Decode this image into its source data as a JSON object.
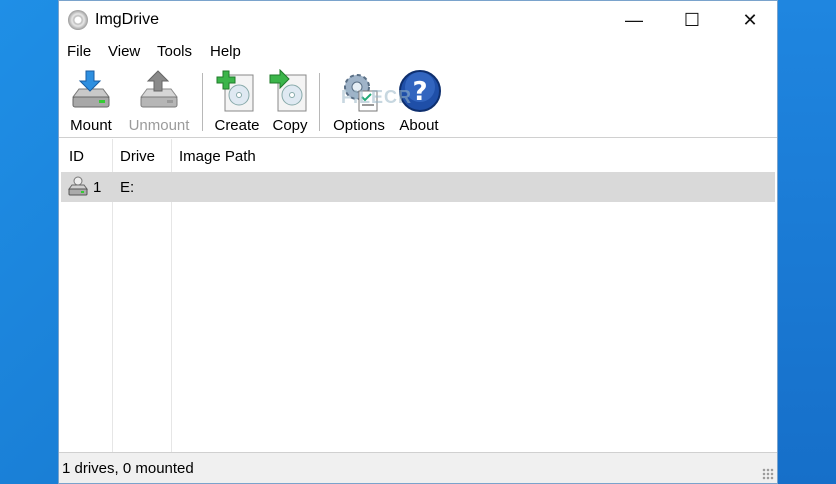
{
  "window": {
    "title": "ImgDrive"
  },
  "window_controls": {
    "minimize": "—",
    "maximize": "☐",
    "close": "✕"
  },
  "menu": [
    "File",
    "View",
    "Tools",
    "Help"
  ],
  "toolbar": {
    "mount": "Mount",
    "unmount": "Unmount",
    "create": "Create",
    "copy": "Copy",
    "options": "Options",
    "about": "About"
  },
  "watermark": "FILECR",
  "table": {
    "columns": [
      "ID",
      "Drive",
      "Image Path"
    ],
    "rows": [
      {
        "id": "1",
        "drive": "E:",
        "path": ""
      }
    ]
  },
  "status": "1 drives, 0 mounted",
  "icons": {
    "app": "disc-icon",
    "mount": "drive-download-icon",
    "unmount": "drive-upload-icon",
    "create": "disc-plus-icon",
    "copy": "disc-arrow-icon",
    "options": "gear-checklist-icon",
    "about": "help-icon",
    "row": "drive-icon"
  }
}
